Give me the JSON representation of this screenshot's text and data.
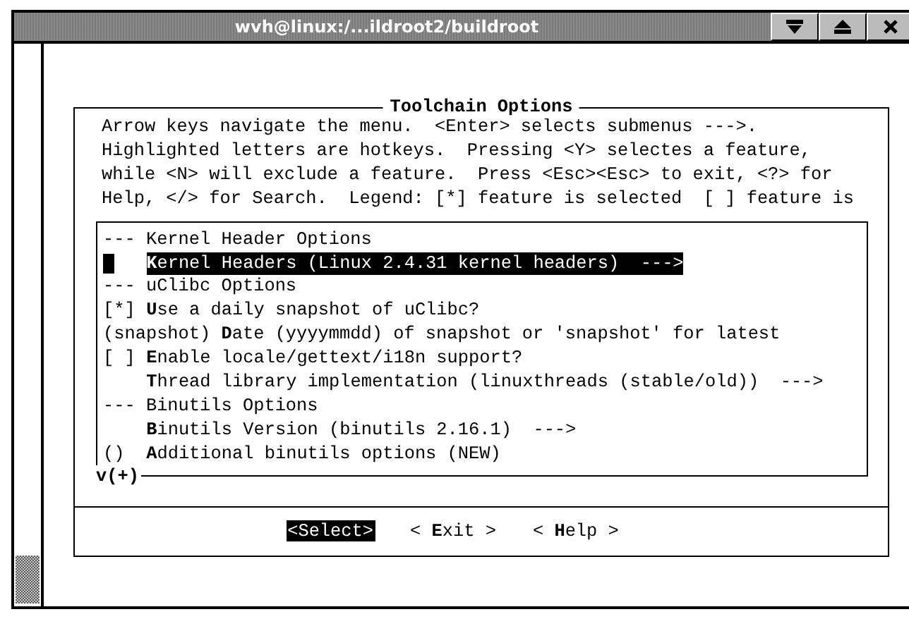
{
  "window": {
    "title": "wvh@linux:/...ildroot2/buildroot"
  },
  "dialog": {
    "title": "Toolchain Options",
    "help_lines": [
      "Arrow keys navigate the menu.  <Enter> selects submenus --->.",
      "Highlighted letters are hotkeys.  Pressing <Y> selectes a feature,",
      "while <N> will exclude a feature.  Press <Esc><Esc> to exit, <?> for",
      "Help, </> for Search.  Legend: [*] feature is selected  [ ] feature is"
    ],
    "menu_items": [
      {
        "kind": "header",
        "label": "--- Kernel Header Options",
        "selected": false
      },
      {
        "kind": "submenu",
        "label": "**K**ernel Headers (Linux 2.4.31 kernel headers)  --->",
        "selected": true
      },
      {
        "kind": "header",
        "label": "--- uClibc Options",
        "selected": false
      },
      {
        "kind": "option",
        "prefix": "[*]",
        "label": "**U**se a daily snapshot of uClibc?",
        "selected": false
      },
      {
        "kind": "option",
        "prefix": "(snapshot)",
        "label": "**D**ate (yyyymmdd) of snapshot or 'snapshot' for latest",
        "selected": false
      },
      {
        "kind": "option",
        "prefix": "[ ]",
        "label": "**E**nable locale/gettext/i18n support?",
        "selected": false
      },
      {
        "kind": "option",
        "label": "**T**hread library implementation (linuxthreads (stable/old))  --->",
        "selected": false
      },
      {
        "kind": "header",
        "label": "--- Binutils Options",
        "selected": false
      },
      {
        "kind": "option",
        "label": "**B**inutils Version (binutils 2.16.1)  --->",
        "selected": false
      },
      {
        "kind": "option",
        "prefix": "()",
        "label": "**A**dditional binutils options (NEW)",
        "selected": false
      }
    ],
    "scroll_indicator": "v(+)",
    "buttons": [
      {
        "label": "<Select>",
        "selected": true
      },
      {
        "label": "< **E**xit >",
        "selected": false
      },
      {
        "label": "< **H**elp >",
        "selected": false
      }
    ]
  }
}
